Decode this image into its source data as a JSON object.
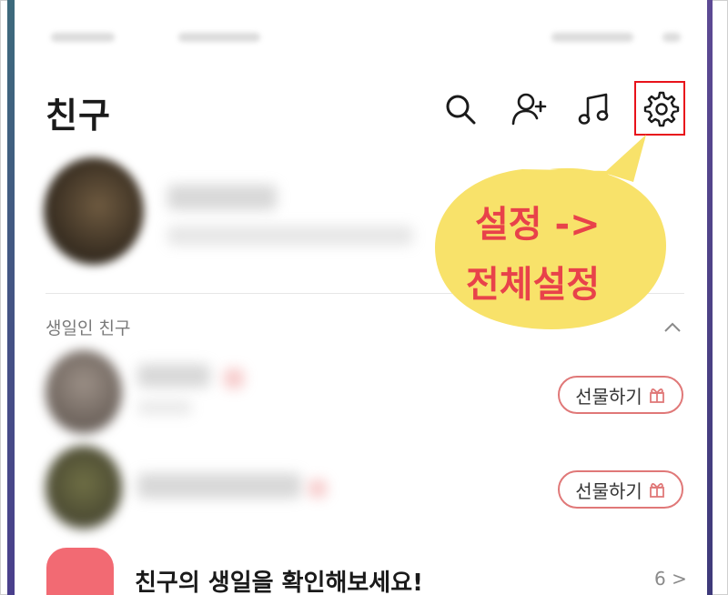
{
  "header": {
    "title": "친구"
  },
  "icons": {
    "search": "search-icon",
    "add_friend": "add-friend-icon",
    "music": "music-icon",
    "settings": "gear-icon"
  },
  "birthday_section": {
    "label": "생일인 친구",
    "friends": [
      {
        "gift_label": "선물하기"
      },
      {
        "gift_label": "선물하기"
      }
    ]
  },
  "annotation": {
    "line1": "설정 ->",
    "line2": "전체설정"
  },
  "birthday_banner": {
    "text": "친구의 생일을 확인해보세요!",
    "count": "6 >"
  },
  "colors": {
    "accent_red": "#e8121b",
    "bubble_yellow": "#f8e26a",
    "bubble_text": "#e8424a",
    "gift_border": "#e07878"
  }
}
